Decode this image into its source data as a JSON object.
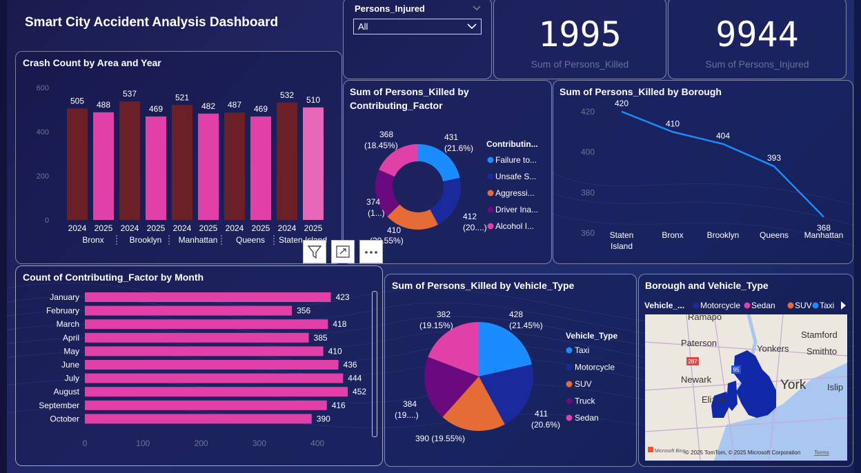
{
  "dashboard_title": "Smart City Accident Analysis Dashboard",
  "slicer": {
    "label": "Persons_Injured",
    "value": "All"
  },
  "kpis": [
    {
      "value": "1995",
      "label": "Sum of Persons_Killed"
    },
    {
      "value": "9944",
      "label": "Sum of Persons_Injured"
    }
  ],
  "colors": {
    "dark_maroon": "#6b2028",
    "pink": "#e040a8",
    "light_pink": "#e866b8",
    "blue": "#1a8cff",
    "navy": "#1a2a9c",
    "orange": "#e66c37",
    "purple": "#6b0a7e",
    "map_blue": "#1129a8"
  },
  "crash_chart": {
    "title": "Crash Count by Area and Year",
    "yticks": [
      "600",
      "400",
      "200",
      "0"
    ],
    "years": [
      "2024",
      "2025",
      "2024",
      "2025",
      "2024",
      "2025",
      "2024",
      "2025",
      "2024",
      "2025"
    ],
    "areas": [
      "Bronx",
      "Brooklyn",
      "Manhattan",
      "Queens",
      "Staten Island"
    ],
    "value_labels": [
      "505",
      "488",
      "537",
      "469",
      "521",
      "482",
      "487",
      "469",
      "532",
      "510"
    ]
  },
  "donut_chart": {
    "title_line1": "Sum of Persons_Killed by",
    "title_line2": "Contributing_Factor",
    "legend_title": "Contributin...",
    "legend": [
      "Failure to...",
      "Unsafe S...",
      "Aggressi...",
      "Driver Ina...",
      "Alcohol I..."
    ],
    "labels": {
      "blue_val": "431",
      "blue_pct": "(21.6%)",
      "navy_val": "412",
      "navy_pct": "(20....)",
      "orange_val": "410",
      "orange_pct": "(20.55%)",
      "purple_val": "374",
      "purple_pct": "(1...)",
      "pink_val": "368",
      "pink_pct": "(18.45%)"
    }
  },
  "borough_chart": {
    "title": "Sum of Persons_Killed by Borough",
    "yticks": [
      "420",
      "400",
      "380",
      "360"
    ],
    "categories": [
      "Staten Island",
      "Bronx",
      "Brooklyn",
      "Queens",
      "Manhattan"
    ],
    "cat_line1": [
      "Staten",
      "Bronx",
      "Brooklyn",
      "Queens",
      "Manhattan"
    ],
    "cat_line2": [
      "Island",
      "",
      "",
      "",
      ""
    ],
    "value_labels": [
      "420",
      "410",
      "404",
      "393",
      "368"
    ]
  },
  "month_chart": {
    "title": "Count of Contributing_Factor by Month",
    "months": [
      "January",
      "February",
      "March",
      "April",
      "May",
      "June",
      "July",
      "August",
      "September",
      "October"
    ],
    "value_labels": [
      "423",
      "356",
      "418",
      "385",
      "410",
      "436",
      "444",
      "452",
      "416",
      "390"
    ],
    "xticks": [
      "0",
      "100",
      "200",
      "300",
      "400"
    ]
  },
  "pie_chart": {
    "title": "Sum of Persons_Killed by Vehicle_Type",
    "legend_title": "Vehicle_Type",
    "legend": [
      "Taxi",
      "Motorcycle",
      "SUV",
      "Truck",
      "Sedan"
    ],
    "labels": {
      "taxi_val": "428",
      "taxi_pct": "(21.45%)",
      "moto_val": "411",
      "moto_pct": "(20.6%)",
      "suv_label": "390 (19.55%)",
      "truck_val": "384",
      "truck_pct": "(19....)",
      "sedan_val": "382",
      "sedan_pct": "(19.15%)"
    }
  },
  "map": {
    "title": "Borough and Vehicle_Type",
    "legend_title": "Vehicle_...",
    "legend": [
      "Motorcycle",
      "Sedan",
      "SUV",
      "Taxi"
    ],
    "places": [
      "Ramapo",
      "Stamford",
      "Paterson",
      "Yonkers",
      "Smithto",
      "Newark",
      "York",
      "Islip",
      "Elizab"
    ],
    "highways": [
      "287",
      "95"
    ],
    "ms_logo": "Microsoft Bing",
    "attribution": "© 2025 TomTom, © 2025 Microsoft Corporation",
    "terms": "Terms"
  },
  "chart_data": [
    {
      "type": "bar",
      "title": "Crash Count by Area and Year",
      "categories": [
        "Bronx 2024",
        "Bronx 2025",
        "Brooklyn 2024",
        "Brooklyn 2025",
        "Manhattan 2024",
        "Manhattan 2025",
        "Queens 2024",
        "Queens 2025",
        "Staten Island 2024",
        "Staten Island 2025"
      ],
      "values": [
        505,
        488,
        537,
        469,
        521,
        482,
        487,
        469,
        532,
        510
      ],
      "ylim": [
        0,
        600
      ]
    },
    {
      "type": "pie",
      "title": "Sum of Persons_Killed by Contributing_Factor",
      "categories": [
        "Failure to...",
        "Unsafe S...",
        "Aggressi...",
        "Driver Ina...",
        "Alcohol I..."
      ],
      "values": [
        431,
        412,
        410,
        374,
        368
      ]
    },
    {
      "type": "line",
      "title": "Sum of Persons_Killed by Borough",
      "categories": [
        "Staten Island",
        "Bronx",
        "Brooklyn",
        "Queens",
        "Manhattan"
      ],
      "values": [
        420,
        410,
        404,
        393,
        368
      ],
      "ylim": [
        355,
        425
      ]
    },
    {
      "type": "bar",
      "title": "Count of Contributing_Factor by Month",
      "categories": [
        "January",
        "February",
        "March",
        "April",
        "May",
        "June",
        "July",
        "August",
        "September",
        "October"
      ],
      "values": [
        423,
        356,
        418,
        385,
        410,
        436,
        444,
        452,
        416,
        390
      ],
      "xlim": [
        0,
        450
      ]
    },
    {
      "type": "pie",
      "title": "Sum of Persons_Killed by Vehicle_Type",
      "categories": [
        "Taxi",
        "Motorcycle",
        "SUV",
        "Truck",
        "Sedan"
      ],
      "values": [
        428,
        411,
        390,
        384,
        382
      ]
    }
  ]
}
